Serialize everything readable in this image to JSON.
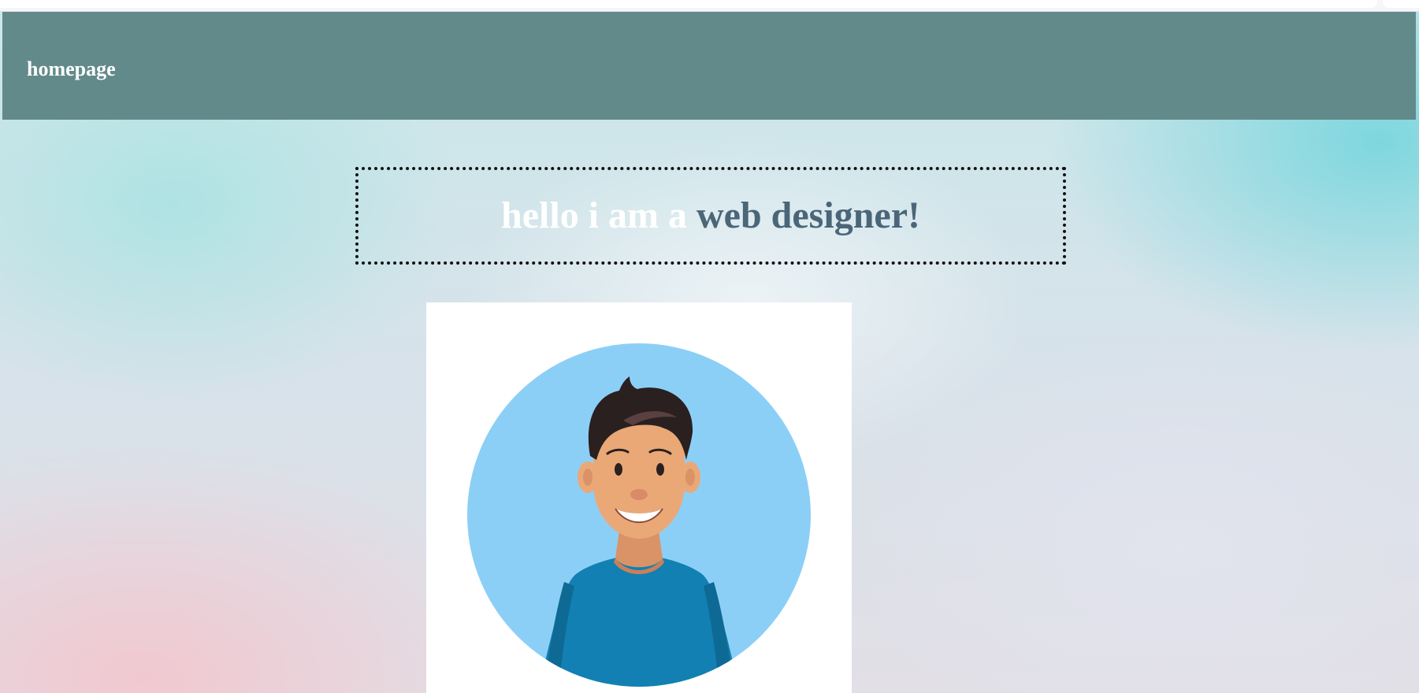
{
  "navbar": {
    "brand": "homepage"
  },
  "hero": {
    "headline_light": "hello i am a ",
    "headline_dark": "web designer!"
  },
  "avatar": {
    "icon": "person-avatar-icon",
    "circle_color": "#8ccff6",
    "shirt_color": "#1280b2",
    "skin_color": "#eaa877",
    "hair_color": "#2a2020"
  },
  "colors": {
    "navbar": "#638a8a",
    "headline_dark": "#4a6678",
    "headline_light": "#ffffff"
  }
}
